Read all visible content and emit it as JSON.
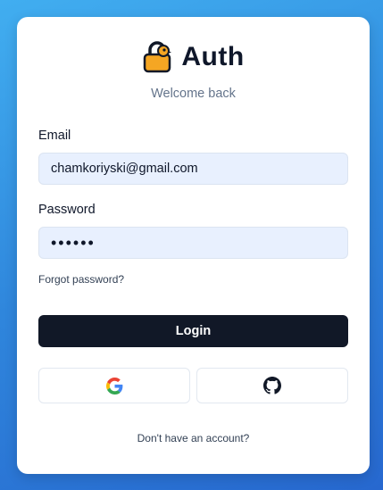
{
  "brand": {
    "title": "Auth",
    "subtitle": "Welcome back",
    "icon": "padlock-bird-icon",
    "icon_color": "#f5a623"
  },
  "form": {
    "email_label": "Email",
    "email_value": "chamkoriyski@gmail.com",
    "password_label": "Password",
    "password_value": "••••••",
    "forgot_link": "Forgot password?",
    "login_label": "Login"
  },
  "oauth": {
    "google_icon": "google-icon",
    "github_icon": "github-icon"
  },
  "footer": {
    "signup_text": "Don't have an account?"
  },
  "colors": {
    "accent_dark": "#111827",
    "input_bg": "#e8f0fe",
    "background_gradient_start": "#41aef0",
    "background_gradient_end": "#2768cf"
  }
}
